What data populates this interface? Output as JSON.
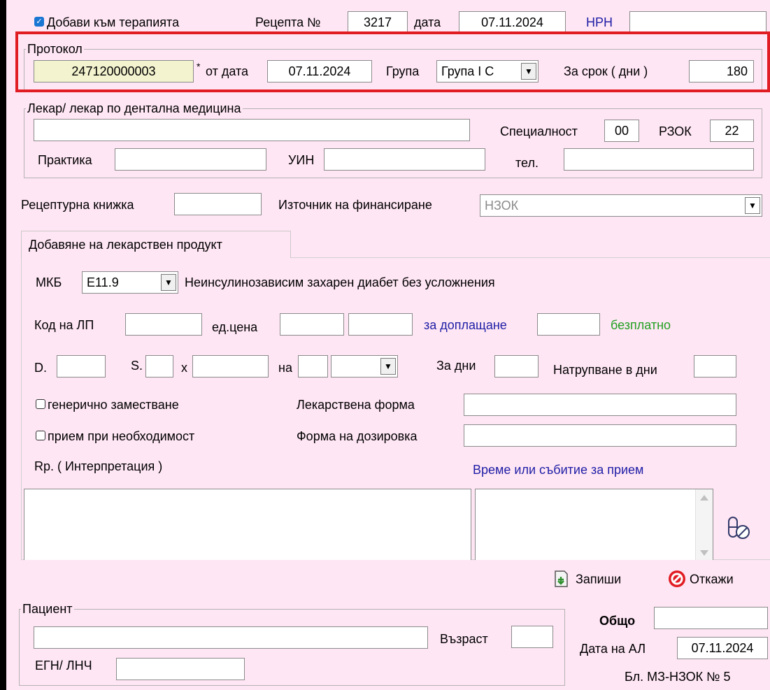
{
  "header": {
    "add_to_therapy": {
      "label": "Добави към терапията",
      "checked": true
    },
    "prescription_no_label": "Рецепта №",
    "prescription_no": "3217",
    "date_label": "дата",
    "date": "07.11.2024",
    "nrn_label": "НРН",
    "nrn": ""
  },
  "protocol": {
    "legend": "Протокол",
    "number": "247120000003",
    "required_mark": "*",
    "from_date_label": "от дата",
    "from_date": "07.11.2024",
    "group_label": "Група",
    "group": "Група I С",
    "term_label": "За срок ( дни )",
    "term_days": "180"
  },
  "doctor": {
    "legend": "Лекар/ лекар по дентална медицина",
    "name": "",
    "specialty_label": "Специалност",
    "specialty": "00",
    "rzok_label": "РЗОК",
    "rzok": "22",
    "practice_label": "Практика",
    "practice": "",
    "uin_label": "УИН",
    "uin": "",
    "phone_label": "тел.",
    "phone": ""
  },
  "prescription_book_label": "Рецептурна книжка",
  "prescription_book": "",
  "funding_label": "Източник на финансиране",
  "funding": "НЗОК",
  "product": {
    "tab_label": "Добавяне на лекарствен продукт",
    "mkb_label": "МКБ",
    "mkb_code": "E11.9",
    "mkb_description": "Неинсулинозависим захарен диабет без усложнения",
    "code_label": "Код на ЛП",
    "unit_price_label": "ед.цена",
    "copay_label": "за доплащане",
    "free_label": "безплатно",
    "d_label": "D.",
    "s_label": "S.",
    "x_label": "x",
    "per_label": "на",
    "days_label": "За дни",
    "accum_label": "Натрупване в дни",
    "generic_label": "генерично заместване",
    "as_needed_label": "прием при необходимост",
    "drug_form_label": "Лекарствена форма",
    "dosage_form_label": "Форма на дозировка",
    "rp_label": "Rp. ( Интерпретация )",
    "time_event_label": "Време или събитие за прием"
  },
  "actions": {
    "save": "Запиши",
    "cancel": "Откажи"
  },
  "patient": {
    "legend": "Пациент",
    "age_label": "Възраст",
    "egn_label": "ЕГН/ ЛНЧ"
  },
  "summary": {
    "total_label": "Общо",
    "al_date_label": "Дата на АЛ",
    "al_date": "07.11.2024",
    "form_no": "Бл. МЗ-НЗОК № 5"
  },
  "colors": {
    "background": "#ffe6f4",
    "highlight": "#e11d24",
    "protocol_field": "#f3f3cf",
    "link": "#1e1ea6",
    "free": "#21a021"
  }
}
